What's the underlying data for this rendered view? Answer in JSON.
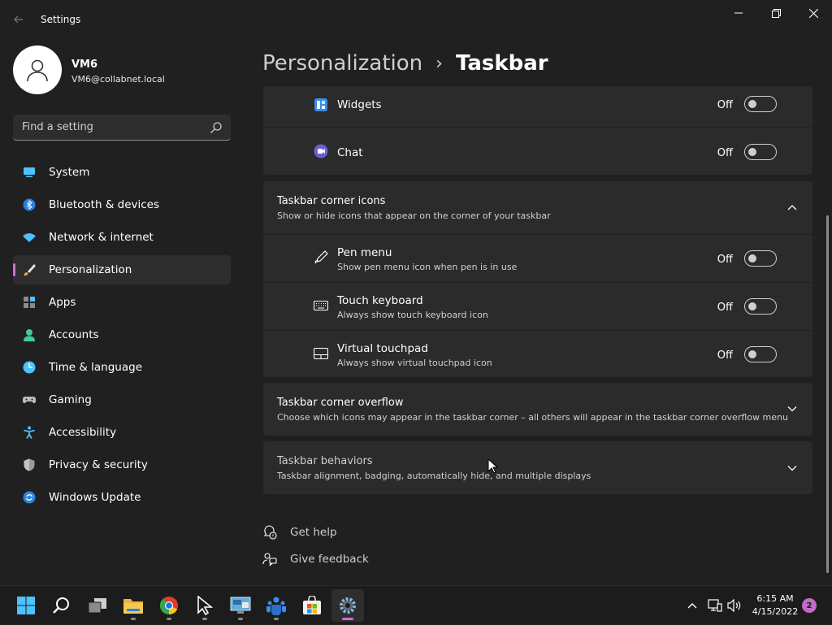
{
  "window": {
    "title": "Settings"
  },
  "user": {
    "name": "VM6",
    "email": "VM6@collabnet.local"
  },
  "search": {
    "placeholder": "Find a setting"
  },
  "sidebar": {
    "items": [
      {
        "label": "System",
        "icon": "system-icon"
      },
      {
        "label": "Bluetooth & devices",
        "icon": "bluetooth-icon"
      },
      {
        "label": "Network & internet",
        "icon": "wifi-icon"
      },
      {
        "label": "Personalization",
        "icon": "brush-icon",
        "active": true
      },
      {
        "label": "Apps",
        "icon": "apps-icon"
      },
      {
        "label": "Accounts",
        "icon": "accounts-icon"
      },
      {
        "label": "Time & language",
        "icon": "clock-icon"
      },
      {
        "label": "Gaming",
        "icon": "controller-icon"
      },
      {
        "label": "Accessibility",
        "icon": "accessibility-icon"
      },
      {
        "label": "Privacy & security",
        "icon": "shield-icon"
      },
      {
        "label": "Windows Update",
        "icon": "update-icon"
      }
    ]
  },
  "breadcrumb": {
    "parent": "Personalization",
    "separator": "›",
    "current": "Taskbar"
  },
  "taskbar_items": {
    "widgets": {
      "label": "Widgets",
      "state": "Off"
    },
    "chat": {
      "label": "Chat",
      "state": "Off"
    }
  },
  "corner_icons": {
    "title": "Taskbar corner icons",
    "description": "Show or hide icons that appear on the corner of your taskbar",
    "pen_menu": {
      "label": "Pen menu",
      "description": "Show pen menu icon when pen is in use",
      "state": "Off"
    },
    "touch_keyboard": {
      "label": "Touch keyboard",
      "description": "Always show touch keyboard icon",
      "state": "Off"
    },
    "virtual_touchpad": {
      "label": "Virtual touchpad",
      "description": "Always show virtual touchpad icon",
      "state": "Off"
    }
  },
  "corner_overflow": {
    "title": "Taskbar corner overflow",
    "description": "Choose which icons may appear in the taskbar corner – all others will appear in the taskbar corner overflow menu"
  },
  "behaviors": {
    "title": "Taskbar behaviors",
    "description": "Taskbar alignment, badging, automatically hide, and multiple displays"
  },
  "links": {
    "help": "Get help",
    "feedback": "Give feedback"
  },
  "system_taskbar": {
    "apps": [
      "start-icon",
      "search-icon",
      "task-view-icon",
      "file-explorer-icon",
      "chrome-icon",
      "cursor-app-icon",
      "remote-desktop-icon",
      "teams-icon",
      "store-icon",
      "settings-icon"
    ],
    "time": "6:15 AM",
    "date": "4/15/2022",
    "notifications": "2"
  },
  "colors": {
    "accent": "#d16dd4",
    "background": "#202020",
    "card": "#2b2b2b"
  }
}
